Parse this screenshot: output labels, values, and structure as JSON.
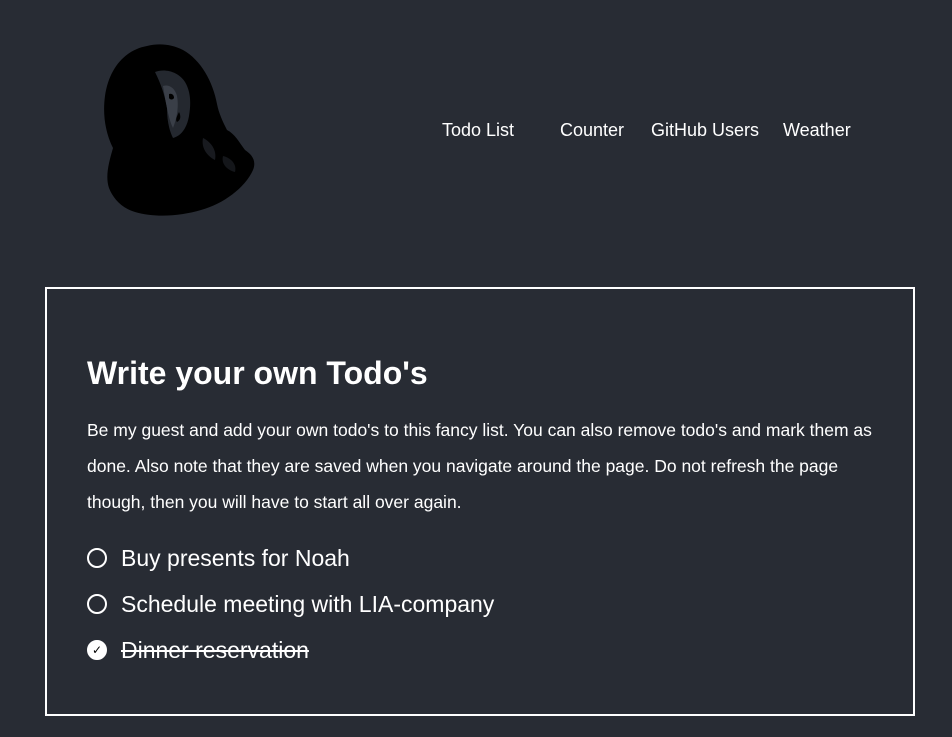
{
  "nav": {
    "items": [
      {
        "label": "Todo List"
      },
      {
        "label": "Counter"
      },
      {
        "label": "GitHub Users"
      },
      {
        "label": "Weather"
      }
    ]
  },
  "main": {
    "title": "Write your own Todo's",
    "description": "Be my guest and add your own todo's to this fancy list. You can also remove todo's and mark them as done. Also note that they are saved when you navigate around the page. Do not refresh the page though, then you will have to start all over again.",
    "todos": [
      {
        "text": "Buy presents for Noah",
        "done": false
      },
      {
        "text": "Schedule meeting with LIA-company",
        "done": false
      },
      {
        "text": "Dinner reservation",
        "done": true
      }
    ]
  },
  "colors": {
    "background": "#282c34",
    "text": "#ffffff",
    "border": "#ffffff"
  },
  "icons": {
    "logo": "portrait-logo",
    "check": "check-icon"
  }
}
